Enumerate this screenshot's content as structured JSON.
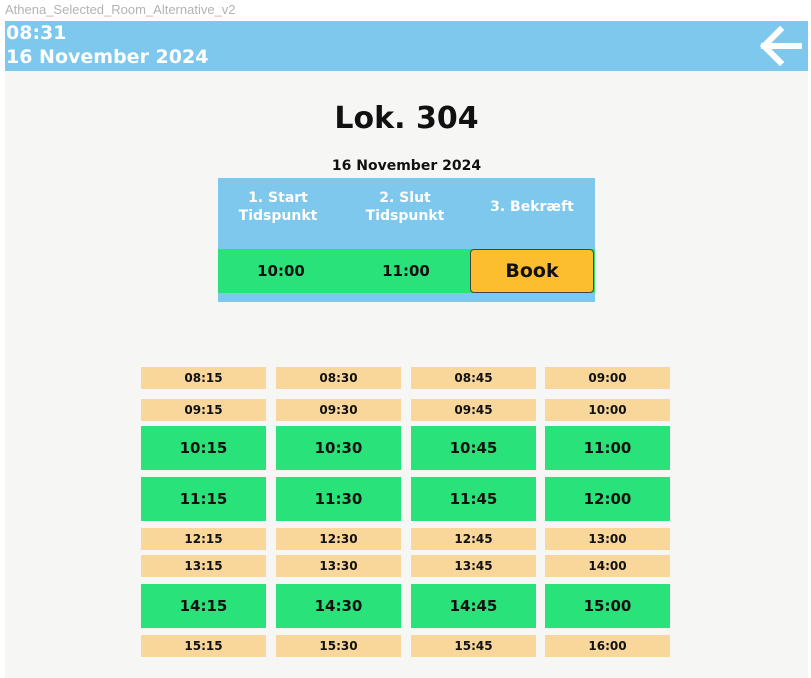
{
  "frame_label": "Athena_Selected_Room_Alternative_v2",
  "header": {
    "time": "08:31",
    "date": "16 November 2024",
    "back_icon": "arrow-left-icon"
  },
  "room": {
    "title": "Lok. 304"
  },
  "booking": {
    "date": "16 November 2024",
    "steps": [
      "1. Start\nTidspunkt",
      "2. Slut\nTidspunkt",
      "3. Bekræft"
    ],
    "start_time": "10:00",
    "end_time": "11:00",
    "book_label": "Book"
  },
  "slots": {
    "rows": [
      {
        "kind": "free",
        "times": [
          "08:15",
          "08:30",
          "08:45",
          "09:00"
        ]
      },
      {
        "kind": "free",
        "times": [
          "09:15",
          "09:30",
          "09:45",
          "10:00"
        ]
      },
      {
        "kind": "selected",
        "times": [
          "10:15",
          "10:30",
          "10:45",
          "11:00"
        ]
      },
      {
        "kind": "selected",
        "times": [
          "11:15",
          "11:30",
          "11:45",
          "12:00"
        ]
      },
      {
        "kind": "free",
        "times": [
          "12:15",
          "12:30",
          "12:45",
          "13:00"
        ]
      },
      {
        "kind": "free",
        "times": [
          "13:15",
          "13:30",
          "13:45",
          "14:00"
        ]
      },
      {
        "kind": "selected",
        "times": [
          "14:15",
          "14:30",
          "14:45",
          "15:00"
        ]
      },
      {
        "kind": "free",
        "times": [
          "15:15",
          "15:30",
          "15:45",
          "16:00"
        ]
      }
    ]
  },
  "colors": {
    "header_bg": "#7dc8ec",
    "selected_slot": "#2ae27a",
    "free_slot": "#f9d69a",
    "book_button": "#fcbd2e"
  }
}
